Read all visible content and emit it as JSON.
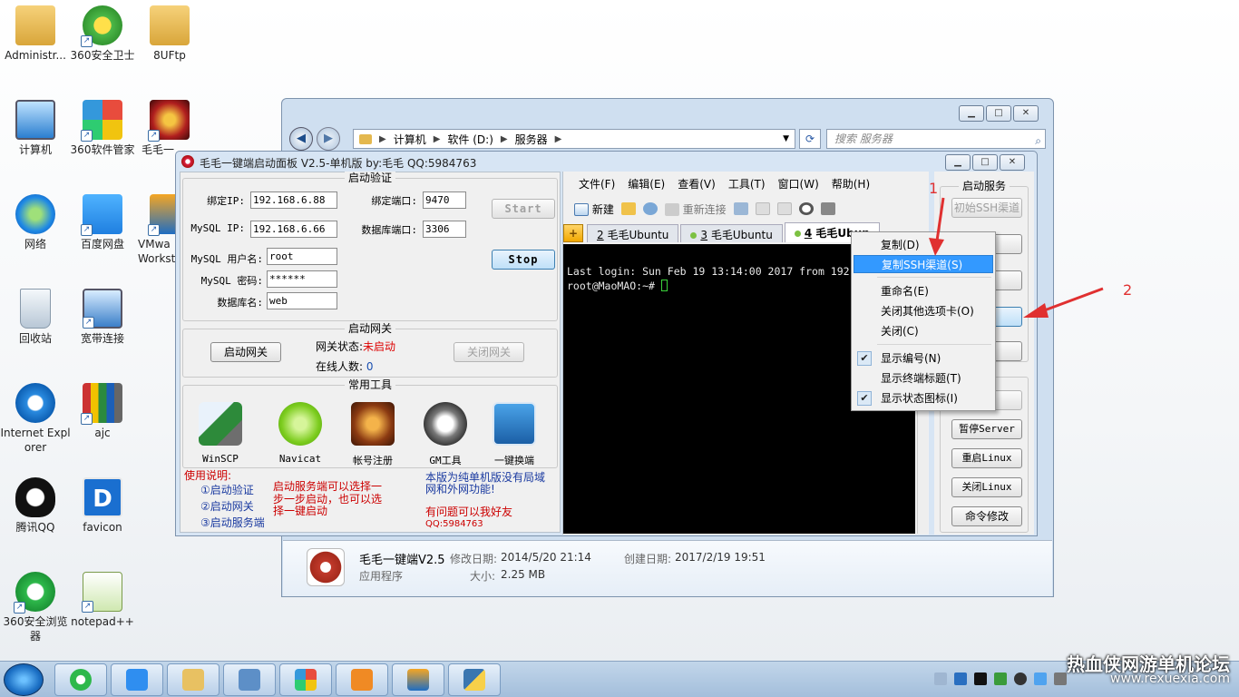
{
  "desktop_icons": [
    {
      "label": "Administr..."
    },
    {
      "label": "360安全卫士"
    },
    {
      "label": "8UFtp"
    },
    {
      "label": "计算机"
    },
    {
      "label": "360软件管家"
    },
    {
      "label": "毛毛一"
    },
    {
      "label": "网络"
    },
    {
      "label": "百度网盘"
    },
    {
      "label": "VMwa\nWorkst"
    },
    {
      "label": "回收站"
    },
    {
      "label": "宽带连接"
    },
    {
      "label": "Internet Explorer"
    },
    {
      "label": "ajc"
    },
    {
      "label": "腾讯QQ"
    },
    {
      "label": "favicon"
    },
    {
      "label": "360安全浏览器"
    },
    {
      "label": "notepad++"
    }
  ],
  "explorer": {
    "breadcrumb": [
      "计算机",
      "软件 (D:)",
      "服务器"
    ],
    "search_placeholder": "搜索 服务器",
    "details": {
      "name": "毛毛一键端V2.5",
      "modified_label": "修改日期:",
      "modified": "2014/5/20 21:14",
      "created_label": "创建日期:",
      "created": "2017/2/19 19:51",
      "type": "应用程序",
      "size_label": "大小:",
      "size": "2.25 MB"
    }
  },
  "panel": {
    "title": "毛毛一键端启动面板 V2.5-单机版 by:毛毛  QQ:5984763",
    "auth": {
      "title": "启动验证",
      "bind_ip_label": "绑定IP:",
      "bind_ip": "192.168.6.88",
      "bind_port_label": "绑定端口:",
      "bind_port": "9470",
      "mysql_ip_label": "MySQL IP:",
      "mysql_ip": "192.168.6.66",
      "db_port_label": "数据库端口:",
      "db_port": "3306",
      "mysql_user_label": "MySQL 用户名:",
      "mysql_user": "root",
      "mysql_pass_label": "MySQL 密码:",
      "mysql_pass": "******",
      "db_name_label": "数据库名:",
      "db_name": "web",
      "start": "Start",
      "stop": "Stop"
    },
    "gateway": {
      "title": "启动网关",
      "start": "启动网关",
      "status_label": "网关状态:",
      "status": "未启动",
      "online_label": "在线人数:",
      "online": "0",
      "close": "关闭网关"
    },
    "tools": {
      "title": "常用工具",
      "items": [
        "WinSCP",
        "Navicat",
        "帐号注册",
        "GM工具",
        "一键换端"
      ]
    },
    "usage": {
      "title": "使用说明:",
      "steps": [
        "①启动验证",
        "②启动网关",
        "③启动服务端"
      ],
      "note1_l1": "启动服务端可以选择一",
      "note1_l2": "步一步启动，也可以选",
      "note1_l3": "择一键启动",
      "note2_l1": "本版为纯单机版没有局域",
      "note2_l2": "网和外网功能!",
      "note3": "有问题可以我好友",
      "qq": "QQ:5984763"
    }
  },
  "terminal": {
    "menu": [
      "文件(F)",
      "编辑(E)",
      "查看(V)",
      "工具(T)",
      "窗口(W)",
      "帮助(H)"
    ],
    "toolbar": {
      "new": "新建",
      "reconnect": "重新连接"
    },
    "tabs": [
      {
        "num": "2",
        "label": "毛毛Ubuntu"
      },
      {
        "num": "3",
        "label": "毛毛Ubuntu"
      },
      {
        "num": "4",
        "label": "毛毛Ubun"
      }
    ],
    "lines": [
      "Last login: Sun Feb 19 13:14:00 2017 from 192",
      "root@MaoMAO:~# "
    ]
  },
  "services": {
    "title": "启动服务",
    "init_ssh": "初始SSH渠道",
    "pause": "暂停Server",
    "restart": "重启Linux",
    "shutdown": "关闭Linux",
    "cmd_edit": "命令修改"
  },
  "context_menu": {
    "items": [
      {
        "label": "复制(D)"
      },
      {
        "label": "复制SSH渠道(S)"
      },
      {
        "label": "重命名(E)"
      },
      {
        "label": "关闭其他选项卡(O)"
      },
      {
        "label": "关闭(C)"
      },
      {
        "label": "显示编号(N)"
      },
      {
        "label": "显示终端标题(T)"
      },
      {
        "label": "显示状态图标(I)"
      }
    ]
  },
  "annotations": {
    "one": "1",
    "two": "2"
  },
  "watermark": {
    "line1": "热血侠网游单机论坛",
    "line2": "www.rexuexia.com"
  },
  "colors": {
    "accent": "#3399ff",
    "annotation": "#e03030",
    "status_red": "#dd0000",
    "terminal_bg": "#000000"
  }
}
